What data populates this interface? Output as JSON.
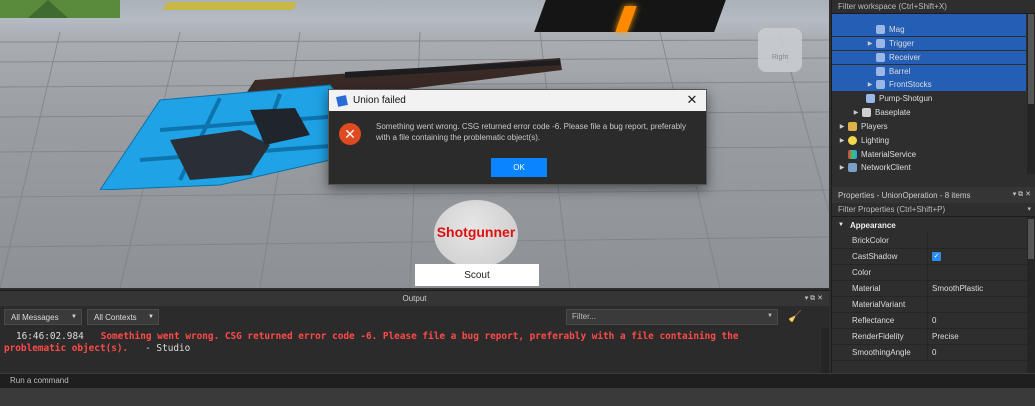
{
  "viewport": {
    "viewcube_label": "Right",
    "character_label": "Shotgunner",
    "scout_button_label": "Scout"
  },
  "dialog": {
    "title": "Union failed",
    "message": "Something went wrong. CSG returned error code -6. Please file a bug report, preferably with a file containing the problematic object(s).",
    "ok_label": "OK",
    "close_glyph": "✕"
  },
  "explorer": {
    "filter_placeholder": "Filter workspace (Ctrl+Shift+X)",
    "items": [
      {
        "label": "Mag",
        "selected": true
      },
      {
        "label": "Trigger",
        "selected": true
      },
      {
        "label": "Receiver",
        "selected": true
      },
      {
        "label": "Barrel",
        "selected": true
      },
      {
        "label": "FrontStocks",
        "selected": true
      },
      {
        "label": "Pump-Shotgun",
        "selected": false
      },
      {
        "label": "Baseplate",
        "selected": false
      },
      {
        "label": "Players",
        "selected": false
      },
      {
        "label": "Lighting",
        "selected": false
      },
      {
        "label": "MaterialService",
        "selected": false
      },
      {
        "label": "NetworkClient",
        "selected": false
      }
    ]
  },
  "properties": {
    "title": "Properties - UnionOperation - 8 items",
    "filter_placeholder": "Filter Properties (Ctrl+Shift+P)",
    "section": "Appearance",
    "rows": [
      {
        "name": "BrickColor",
        "value": ""
      },
      {
        "name": "CastShadow",
        "value": "✓"
      },
      {
        "name": "Color",
        "value": ""
      },
      {
        "name": "Material",
        "value": "SmoothPlastic"
      },
      {
        "name": "MaterialVariant",
        "value": ""
      },
      {
        "name": "Reflectance",
        "value": "0"
      },
      {
        "name": "RenderFidelity",
        "value": "Precise"
      },
      {
        "name": "SmoothingAngle",
        "value": "0"
      }
    ]
  },
  "output": {
    "title": "Output",
    "messages_filter": "All Messages",
    "contexts_filter": "All Contexts",
    "filter_placeholder": "Filter...",
    "log_timestamp": "16:46:02.984",
    "log_message": "Something went wrong. CSG returned error code -6. Please file a bug report, preferably with a file containing the problematic object(s).",
    "log_source": "-  Studio"
  },
  "command_bar": {
    "placeholder": "Run a command"
  },
  "colors": {
    "selection": "#245fb5",
    "accent": "#0a84ff",
    "error": "#ff4a4a",
    "part_blue": "#1fa3e6"
  }
}
